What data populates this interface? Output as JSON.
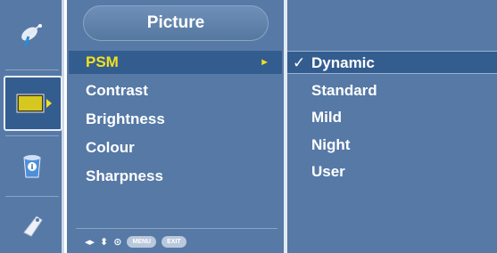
{
  "sidebar": {
    "items": [
      {
        "icon": "satellite-dish-icon"
      },
      {
        "icon": "picture-icon",
        "active": true
      },
      {
        "icon": "info-bucket-icon"
      },
      {
        "icon": "tag-icon"
      }
    ]
  },
  "menu": {
    "title": "Picture",
    "items": [
      {
        "label": "PSM",
        "selected": true,
        "arrow": "►"
      },
      {
        "label": "Contrast"
      },
      {
        "label": "Brightness"
      },
      {
        "label": "Colour"
      },
      {
        "label": "Sharpness"
      }
    ],
    "footer": {
      "nav_left_right": "◂▸",
      "nav_up_down": "⬍",
      "ok": "⊙",
      "menu_label": "MENU",
      "exit_label": "EXIT"
    }
  },
  "submenu": {
    "check": "✓",
    "items": [
      {
        "label": "Dynamic",
        "selected": true
      },
      {
        "label": "Standard"
      },
      {
        "label": "Mild"
      },
      {
        "label": "Night"
      },
      {
        "label": "User"
      }
    ]
  },
  "colors": {
    "panel": "#5679a6",
    "highlight": "#345d8f",
    "selected_text": "#f0e020"
  }
}
